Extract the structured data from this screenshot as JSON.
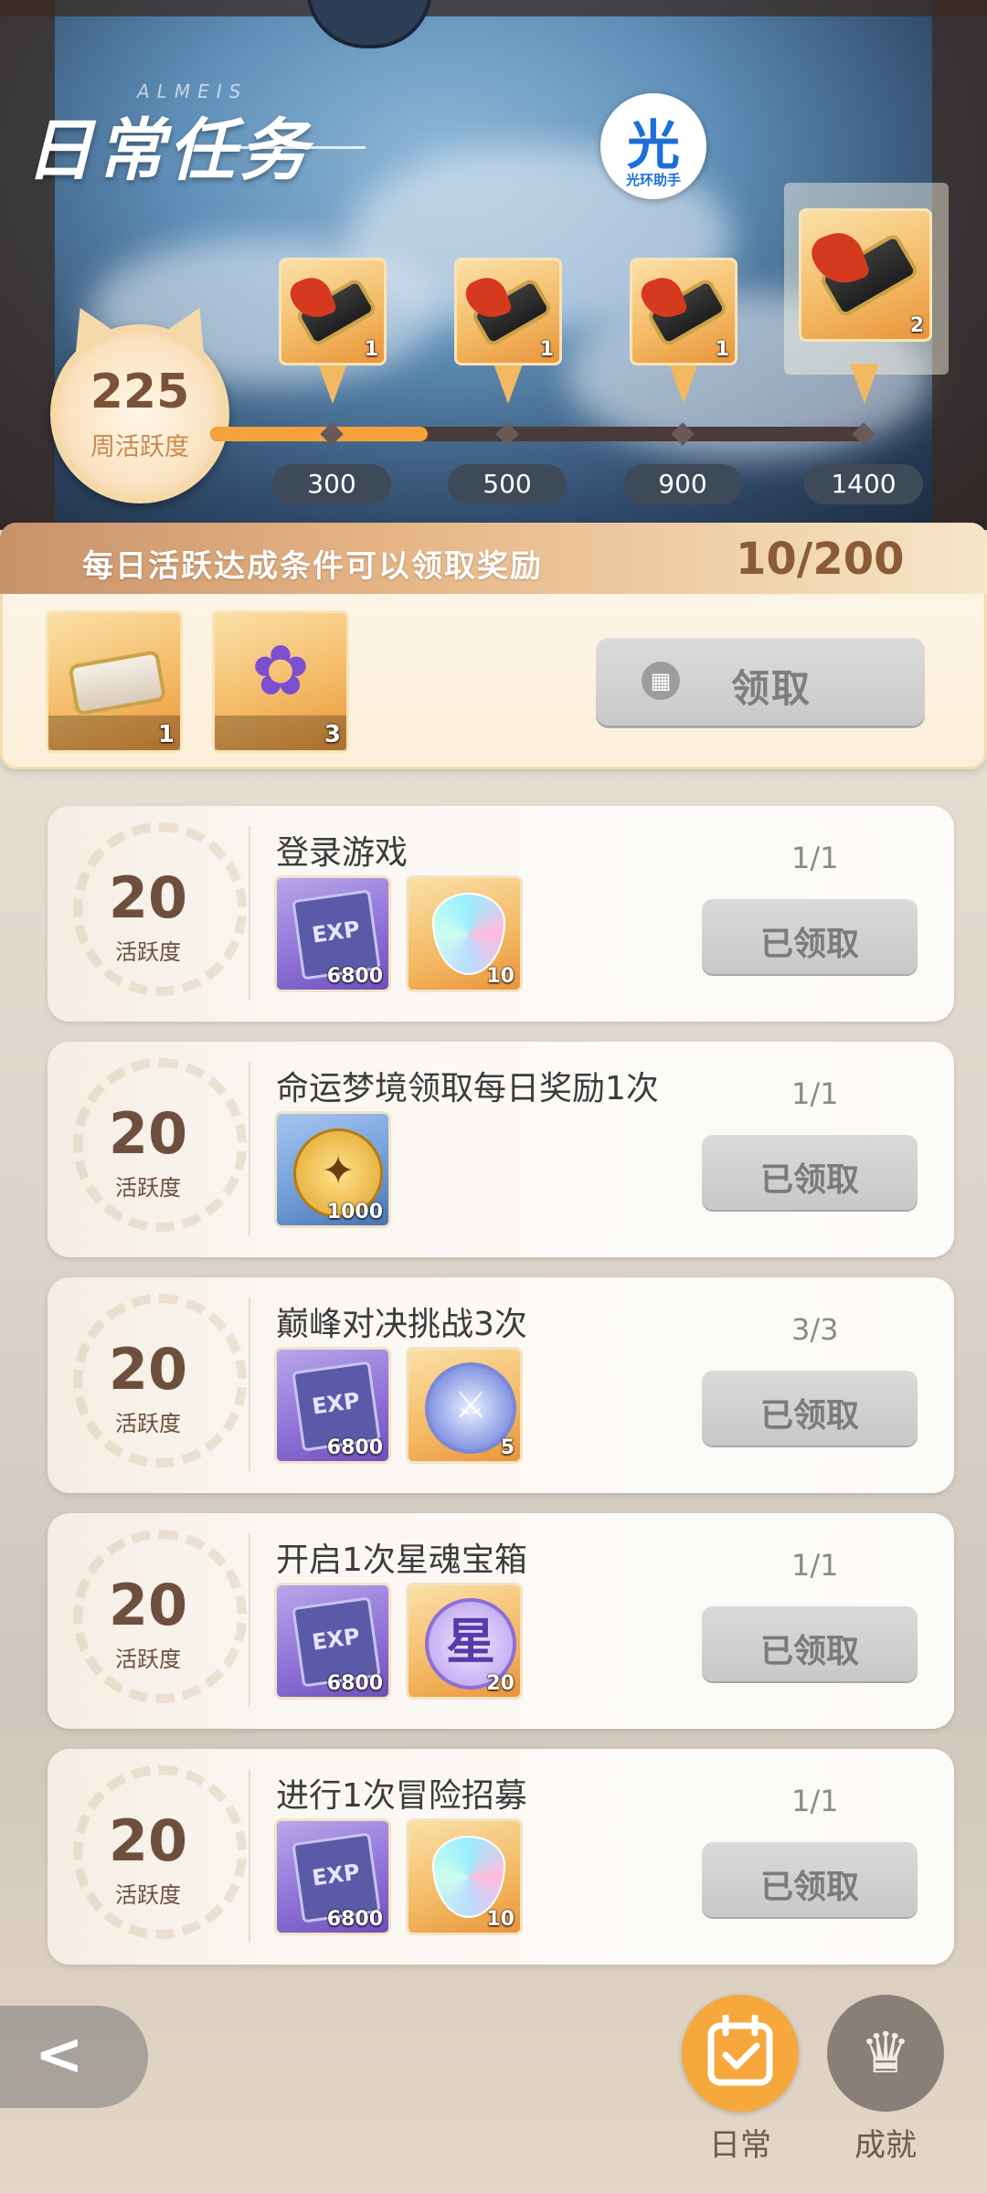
{
  "header": {
    "title": "日常任务",
    "title_deco": "ALMEIS",
    "assistant": {
      "glyph": "光",
      "label": "光环助手"
    }
  },
  "weekly": {
    "value": "225",
    "label": "周活跃度",
    "progress_fill": 0.33,
    "milestones": [
      {
        "value": "300",
        "qty": "1"
      },
      {
        "value": "500",
        "qty": "1"
      },
      {
        "value": "900",
        "qty": "1"
      },
      {
        "value": "1400",
        "qty": "2"
      }
    ]
  },
  "daily": {
    "title": "每日活跃达成条件可以领取奖励",
    "count": "10/200",
    "rewards": [
      {
        "icon": "scroll-icon",
        "qty": "1"
      },
      {
        "icon": "lily-flower-icon",
        "qty": "3"
      }
    ],
    "claim_label": "领取"
  },
  "tasks": [
    {
      "points": "20",
      "points_label": "活跃度",
      "name": "登录游戏",
      "progress": "1/1",
      "button": "已领取",
      "items": [
        {
          "icon": "exp-book-icon",
          "qty": "6800"
        },
        {
          "icon": "rainbow-gem-icon",
          "qty": "10"
        }
      ]
    },
    {
      "points": "20",
      "points_label": "活跃度",
      "name": "命运梦境领取每日奖励1次",
      "progress": "1/1",
      "button": "已领取",
      "items": [
        {
          "icon": "paw-coin-icon",
          "qty": "1000"
        }
      ]
    },
    {
      "points": "20",
      "points_label": "活跃度",
      "name": "巅峰对决挑战3次",
      "progress": "3/3",
      "button": "已领取",
      "items": [
        {
          "icon": "exp-book-icon",
          "qty": "6800"
        },
        {
          "icon": "sword-orb-icon",
          "qty": "5"
        }
      ]
    },
    {
      "points": "20",
      "points_label": "活跃度",
      "name": "开启1次星魂宝箱",
      "progress": "1/1",
      "button": "已领取",
      "items": [
        {
          "icon": "exp-book-icon",
          "qty": "6800"
        },
        {
          "icon": "star-token-icon",
          "qty": "20",
          "glyph": "星"
        }
      ]
    },
    {
      "points": "20",
      "points_label": "活跃度",
      "name": "进行1次冒险招募",
      "progress": "1/1",
      "button": "已领取",
      "items": [
        {
          "icon": "exp-book-icon",
          "qty": "6800"
        },
        {
          "icon": "rainbow-gem-icon",
          "qty": "10"
        }
      ]
    }
  ],
  "nav": {
    "back_glyph": "<",
    "tabs": [
      {
        "label": "日常",
        "icon": "calendar-check-icon",
        "active": true
      },
      {
        "label": "成就",
        "icon": "crown-icon",
        "active": false
      }
    ]
  },
  "colors": {
    "accent": "#f6a83d",
    "banner_text": "#8b5a36",
    "done_button": "#c9c9c9"
  }
}
